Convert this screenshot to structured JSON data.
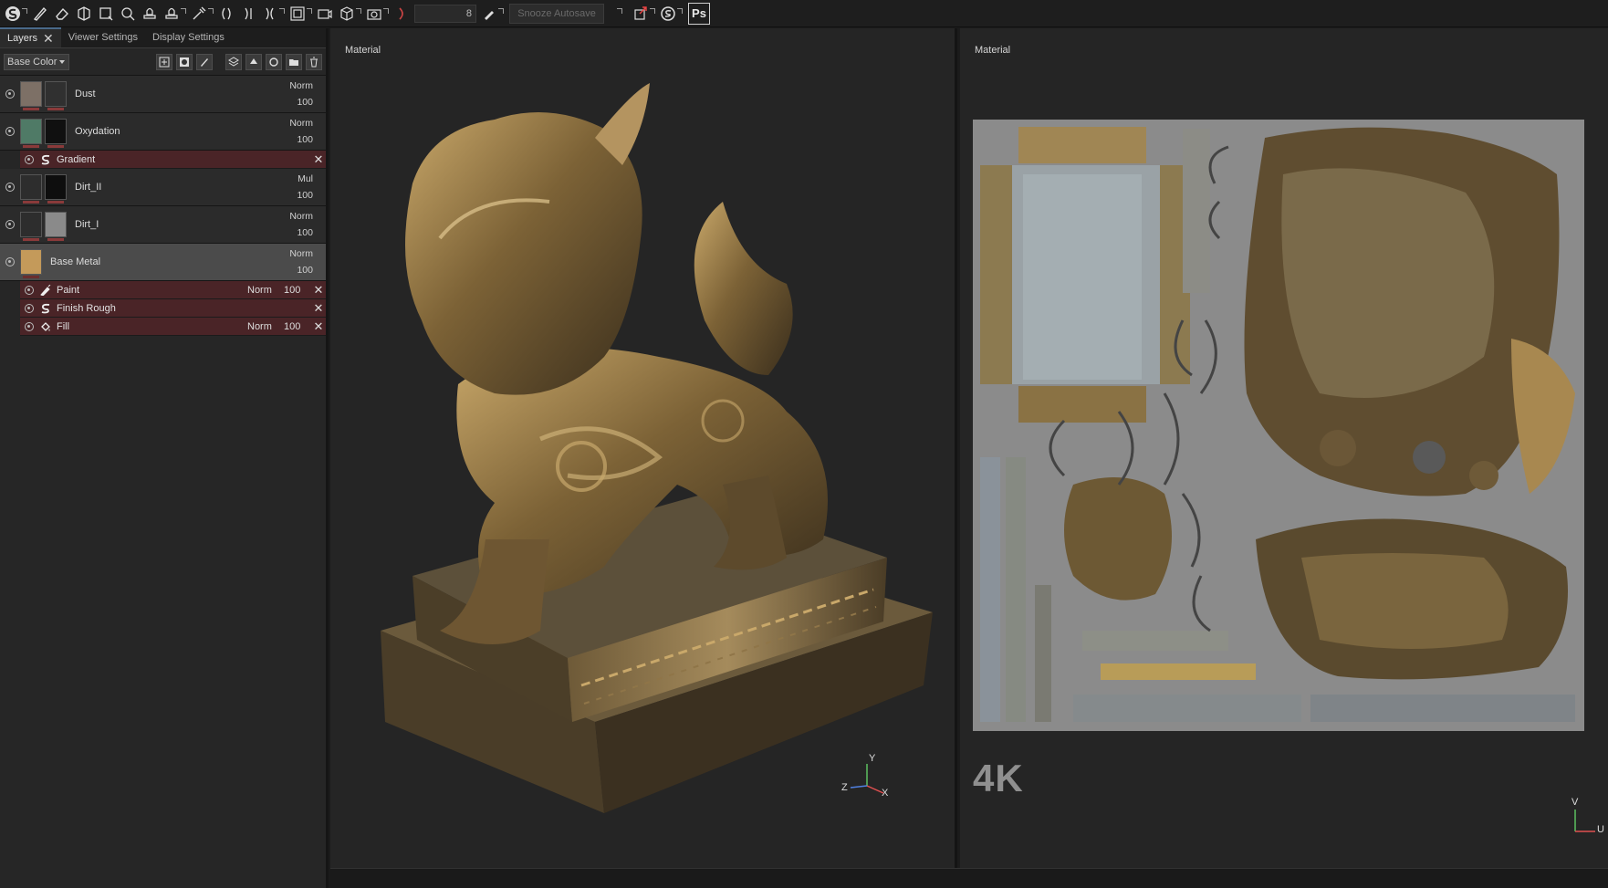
{
  "toolbar": {
    "brush_size": "8",
    "snooze_autosave": "Snooze Autosave",
    "photoshop_label": "Ps"
  },
  "left_panel": {
    "tabs": [
      {
        "label": "Layers"
      },
      {
        "label": "Viewer Settings"
      },
      {
        "label": "Display Settings"
      }
    ],
    "channel": "Base Color",
    "layers": [
      {
        "name": "Dust",
        "mode": "Norm",
        "opacity": "100",
        "thumb_color": "#7d7066"
      },
      {
        "name": "Oxydation",
        "mode": "Norm",
        "opacity": "100",
        "thumb_color": "#4f7a66"
      },
      {
        "name": "Dirt_II",
        "mode": "Mul",
        "opacity": "100",
        "thumb_color": "#2d2d2d"
      },
      {
        "name": "Dirt_I",
        "mode": "Norm",
        "opacity": "100",
        "thumb_color": "#2d2d2d"
      },
      {
        "name": "Base Metal",
        "mode": "Norm",
        "opacity": "100",
        "thumb_color": "#c49a5a"
      }
    ],
    "oxydation_effect": {
      "name": "Gradient"
    },
    "base_metal_effects": [
      {
        "name": "Paint",
        "mode": "Norm",
        "opacity": "100",
        "icon": "brush-icon"
      },
      {
        "name": "Finish Rough",
        "mode": "",
        "opacity": "",
        "icon": "substance-icon"
      },
      {
        "name": "Fill",
        "mode": "Norm",
        "opacity": "100",
        "icon": "fill-icon"
      }
    ]
  },
  "viewport_3d": {
    "label": "Material",
    "axis_x": "X",
    "axis_y": "Y",
    "axis_z": "Z"
  },
  "viewport_2d": {
    "label": "Material",
    "resolution": "4K",
    "axis_u": "U",
    "axis_v": "V"
  }
}
